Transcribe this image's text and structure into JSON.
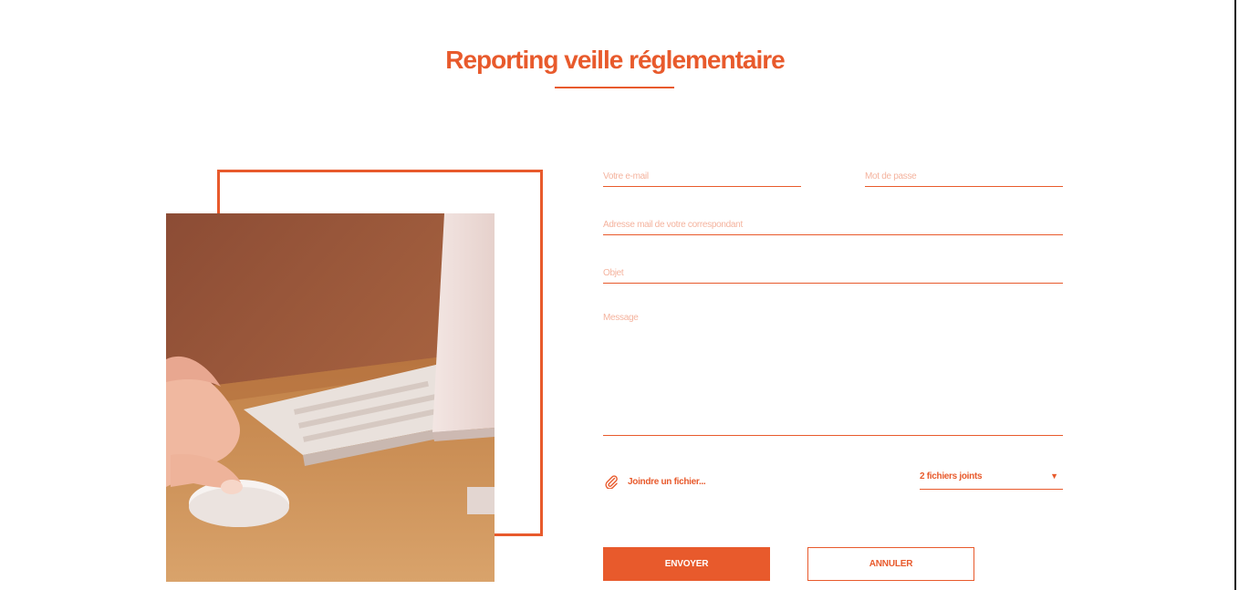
{
  "page": {
    "title": "Reporting veille réglementaire"
  },
  "form": {
    "email_placeholder": "Votre e-mail",
    "password_placeholder": "Mot de passe",
    "correspondent_placeholder": "Adresse mail de votre correspondant",
    "subject_placeholder": "Objet",
    "message_placeholder": "Message",
    "attach_label": "Joindre un fichier...",
    "attached_files_selected": "2 fichiers joints",
    "submit_label": "ENVOYER",
    "cancel_label": "ANNULER"
  },
  "icons": {
    "attach": "paperclip-icon",
    "dropdown": "caret-down-icon"
  },
  "colors": {
    "accent": "#e85a2c"
  }
}
